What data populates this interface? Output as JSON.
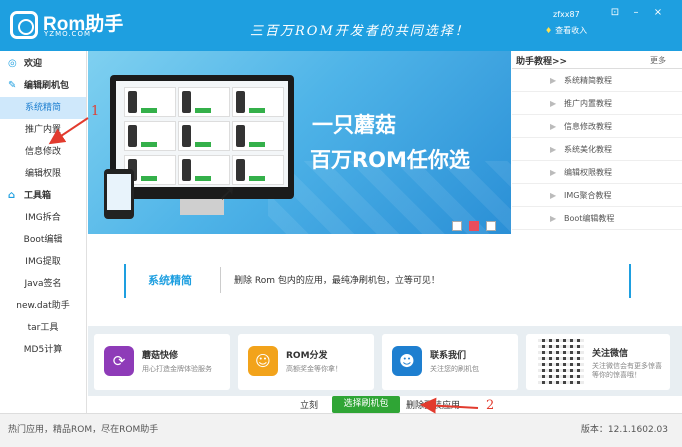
{
  "header": {
    "logo_title": "Rom助手",
    "logo_sub": "YZMO.COM",
    "slogan": "三百万ROM开发者的共同选择！",
    "user_name": "zfxx87",
    "user_link": "查看收入",
    "window_buttons": [
      "⊡",
      "–",
      "×"
    ]
  },
  "sidebar": {
    "welcome": "欢迎",
    "section_edit": "编辑刷机包",
    "edit_items": [
      "系统精简",
      "推广内置",
      "信息修改",
      "编辑权限"
    ],
    "section_tools": "工具箱",
    "tool_items": [
      "IMG拆合",
      "Boot编辑",
      "IMG提取",
      "Java签名",
      "new.dat助手",
      "tar工具",
      "MD5计算"
    ]
  },
  "banner": {
    "line1": "一只蘑菇",
    "line2": "百万ROM任你选",
    "slides": 3,
    "active_slide": 2
  },
  "tutorials": {
    "title": "助手教程>>",
    "more": "更多",
    "items": [
      "系统精简教程",
      "推广内置教程",
      "信息修改教程",
      "系统美化教程",
      "编辑权限教程",
      "IMG聚合教程",
      "Boot编辑教程"
    ]
  },
  "info": {
    "title": "系统精简",
    "desc": "删除 Rom 包内的应用，最纯净刷机包，立等可见！"
  },
  "cards": [
    {
      "title": "蘑菇快修",
      "sub": "用心打造金牌体验服务",
      "icon": "mushroom-repair-icon",
      "color": "#8e3bb8"
    },
    {
      "title": "ROM分发",
      "sub": "高额奖金等你拿！",
      "icon": "rom-distribute-icon",
      "color": "#f2a31b"
    },
    {
      "title": "联系我们",
      "sub": "关注您的刷机包",
      "icon": "contact-icon",
      "color": "#1e7fd0"
    },
    {
      "title": "关注微信",
      "sub": "关注微信会有更多惊喜等你的惊喜哦！",
      "icon": "qr-code-icon",
      "color": "#222222"
    }
  ],
  "actions": {
    "prefix": "立刻",
    "button": "选择刷机包",
    "suffix": "删除预装应用"
  },
  "status": {
    "left": "热门应用，精品ROM，尽在ROM助手",
    "right": "版本：12.1.1602.03"
  },
  "annotations": {
    "num1": "1",
    "num2": "2"
  }
}
